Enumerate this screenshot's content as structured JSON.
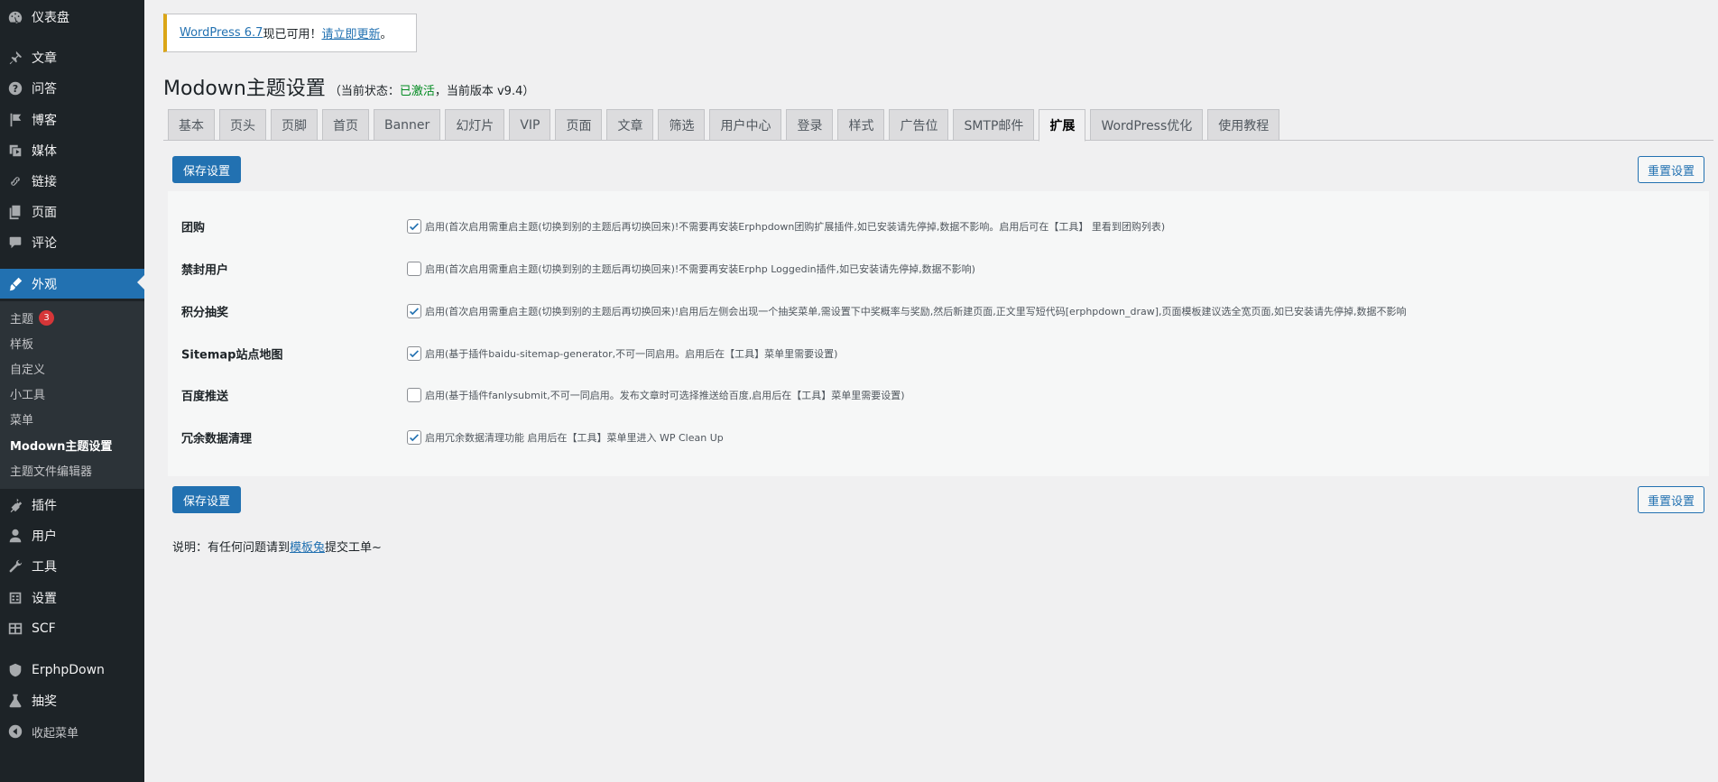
{
  "sidebar": {
    "items": [
      {
        "label": "仪表盘",
        "icon": "dashboard-icon"
      },
      {
        "label": "文章",
        "icon": "pin-icon"
      },
      {
        "label": "问答",
        "icon": "question-icon"
      },
      {
        "label": "博客",
        "icon": "flag-icon"
      },
      {
        "label": "媒体",
        "icon": "media-icon"
      },
      {
        "label": "链接",
        "icon": "link-icon"
      },
      {
        "label": "页面",
        "icon": "page-icon"
      },
      {
        "label": "评论",
        "icon": "comment-icon"
      },
      {
        "label": "外观",
        "icon": "brush-icon"
      },
      {
        "label": "插件",
        "icon": "plugin-icon"
      },
      {
        "label": "用户",
        "icon": "user-icon"
      },
      {
        "label": "工具",
        "icon": "wrench-icon"
      },
      {
        "label": "设置",
        "icon": "settings-icon"
      },
      {
        "label": "SCF",
        "icon": "grid-icon"
      },
      {
        "label": "ErphpDown",
        "icon": "shield-icon"
      },
      {
        "label": "抽奖",
        "icon": "flask-icon"
      },
      {
        "label": "收起菜单",
        "icon": "collapse-icon"
      }
    ],
    "submenu": [
      {
        "label": "主题",
        "badge": "3"
      },
      {
        "label": "样板"
      },
      {
        "label": "自定义"
      },
      {
        "label": "小工具"
      },
      {
        "label": "菜单"
      },
      {
        "label": "Modown主题设置"
      },
      {
        "label": "主题文件编辑器"
      }
    ]
  },
  "notice": {
    "link1": "WordPress 6.7",
    "text": " 现已可用！",
    "link2": "请立即更新",
    "end": "。"
  },
  "header": {
    "title": "Modown主题设置",
    "status_prefix": "（当前状态：",
    "status_active": "已激活",
    "status_suffix": "，当前版本 v9.4）"
  },
  "tabs": [
    "基本",
    "页头",
    "页脚",
    "首页",
    "Banner",
    "幻灯片",
    "VIP",
    "页面",
    "文章",
    "筛选",
    "用户中心",
    "登录",
    "样式",
    "广告位",
    "SMTP邮件",
    "扩展",
    "WordPress优化",
    "使用教程"
  ],
  "active_tab": "扩展",
  "buttons": {
    "save": "保存设置",
    "reset": "重置设置"
  },
  "settings": [
    {
      "label": "团购",
      "checked": true,
      "desc": "启用(首次启用需重启主题(切换到别的主题后再切换回来)!不需要再安装Erphpdown团购扩展插件,如已安装请先停掉,数据不影响。启用后可在【工具】 里看到团购列表)"
    },
    {
      "label": "禁封用户",
      "checked": false,
      "desc": "启用(首次启用需重启主题(切换到别的主题后再切换回来)!不需要再安装Erphp Loggedin插件,如已安装请先停掉,数据不影响)"
    },
    {
      "label": "积分抽奖",
      "checked": true,
      "desc": "启用(首次启用需重启主题(切换到别的主题后再切换回来)!启用后左侧会出现一个抽奖菜单,需设置下中奖概率与奖励,然后新建页面,正文里写短代码[erphpdown_draw],页面模板建议选全宽页面,如已安装请先停掉,数据不影响"
    },
    {
      "label": "Sitemap站点地图",
      "checked": true,
      "desc": "启用(基于插件baidu-sitemap-generator,不可一同启用。启用后在【工具】菜单里需要设置)"
    },
    {
      "label": "百度推送",
      "checked": false,
      "desc": "启用(基于插件fanlysubmit,不可一同启用。发布文章时可选择推送给百度,启用后在【工具】菜单里需要设置)"
    },
    {
      "label": "冗余数据清理",
      "checked": true,
      "desc": "启用冗余数据清理功能 启用后在【工具】菜单里进入 WP Clean Up"
    }
  ],
  "footer": {
    "prefix": "说明：有任何问题请到",
    "link": "模板兔",
    "suffix": "提交工单~"
  },
  "colors": {
    "sidebar_bg": "#1d2327",
    "accent": "#2271b1",
    "active_status": "#008a20",
    "notice_border": "#dba617",
    "badge": "#d63638"
  }
}
